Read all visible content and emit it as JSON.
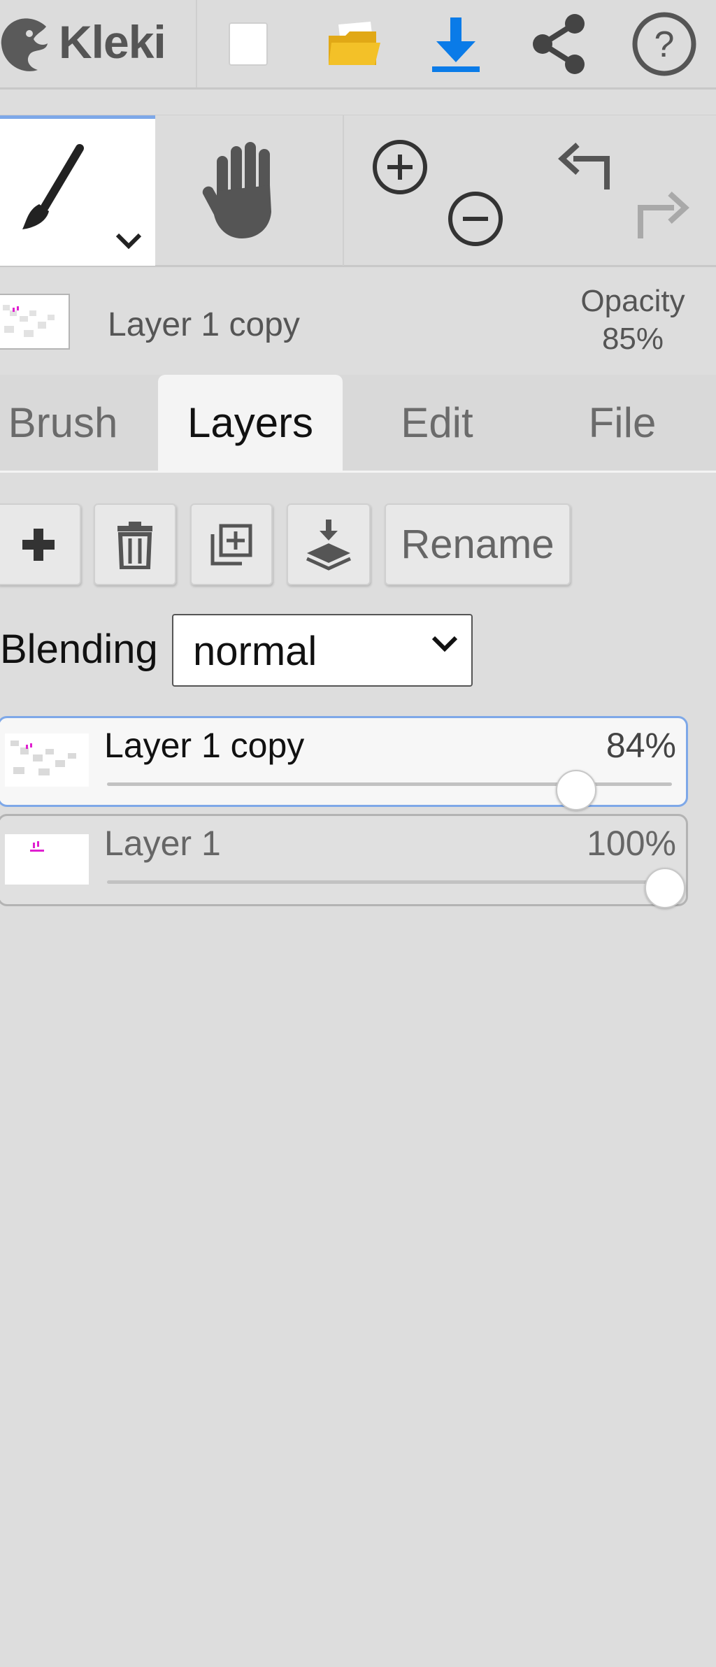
{
  "app": {
    "name": "Kleki"
  },
  "topbar": {
    "items": [
      {
        "icon": "new-image-icon"
      },
      {
        "icon": "open-folder-icon"
      },
      {
        "icon": "download-icon",
        "color": "#0a7be8"
      },
      {
        "icon": "share-icon"
      },
      {
        "icon": "help-icon"
      }
    ]
  },
  "tools": {
    "selected": "brush",
    "items": [
      "brush-icon",
      "hand-icon",
      "zoom-in-icon",
      "zoom-out-icon",
      "undo-icon",
      "redo-icon"
    ]
  },
  "current_layer": {
    "name": "Layer 1 copy",
    "opacity_label": "Opacity",
    "opacity_value": "85%"
  },
  "tabs": {
    "items": [
      {
        "label": "Brush"
      },
      {
        "label": "Layers"
      },
      {
        "label": "Edit"
      },
      {
        "label": "File"
      }
    ],
    "active": "Layers"
  },
  "layer_actions": {
    "buttons": [
      "add-layer-icon",
      "delete-layer-icon",
      "duplicate-layer-icon",
      "merge-down-icon"
    ],
    "rename_label": "Rename"
  },
  "blending": {
    "label": "Blending",
    "value": "normal"
  },
  "layers": [
    {
      "name": "Layer 1 copy",
      "opacity_label": "84%",
      "opacity": 0.84,
      "selected": true
    },
    {
      "name": "Layer 1",
      "opacity_label": "100%",
      "opacity": 1.0,
      "selected": false
    }
  ],
  "colors": {
    "accent": "#7ea8e8",
    "download": "#0a7be8",
    "folder": "#f3c128",
    "background": "#dddddd"
  }
}
